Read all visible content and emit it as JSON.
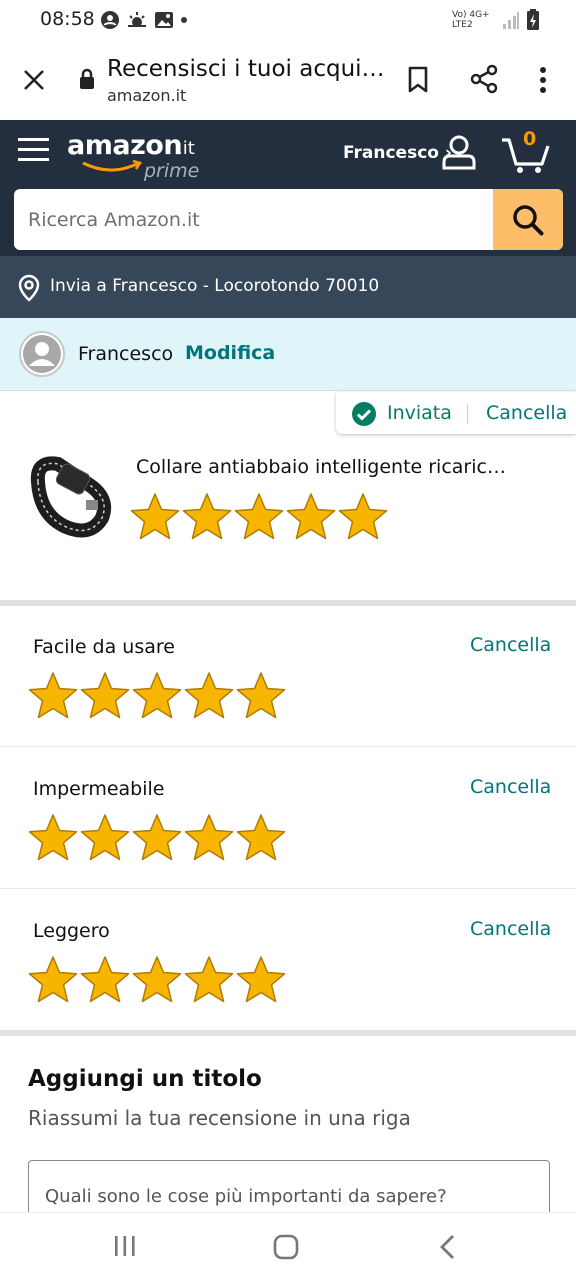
{
  "status_bar": {
    "time": "08:58",
    "network": "Vo) 4G+ LTE2"
  },
  "browser": {
    "page_title": "Recensisci i tuoi acqui…",
    "url": "amazon.it"
  },
  "header": {
    "logo_text": "amazon",
    "logo_tld": ".it",
    "logo_prime": "prime",
    "account_label": "Francesco ›",
    "cart_count": "0"
  },
  "search": {
    "placeholder": "Ricerca Amazon.it"
  },
  "delivery": {
    "text": "Invia a Francesco - Locorotondo 70010"
  },
  "profile": {
    "name": "Francesco",
    "edit_label": "Modifica"
  },
  "submission": {
    "status_label": "Inviata",
    "cancel_label": "Cancella"
  },
  "product": {
    "title": "Collare antiabbaio intelligente ricaric…",
    "rating": 5,
    "max_rating": 5
  },
  "attributes": [
    {
      "label": "Facile da usare",
      "cancel_label": "Cancella",
      "rating": 5
    },
    {
      "label": "Impermeabile",
      "cancel_label": "Cancella",
      "rating": 5
    },
    {
      "label": "Leggero",
      "cancel_label": "Cancella",
      "rating": 5
    }
  ],
  "review_title": {
    "heading": "Aggiungi un titolo",
    "subheading": "Riassumi la tua recensione in una riga",
    "placeholder": "Quali sono le cose più importanti da sapere?"
  },
  "colors": {
    "amazon_dark": "#232f3e",
    "amazon_nav": "#37475a",
    "accent_orange": "#febd69",
    "link_teal": "#00757a",
    "star_gold": "#f7b500",
    "success_green": "#067d62"
  }
}
